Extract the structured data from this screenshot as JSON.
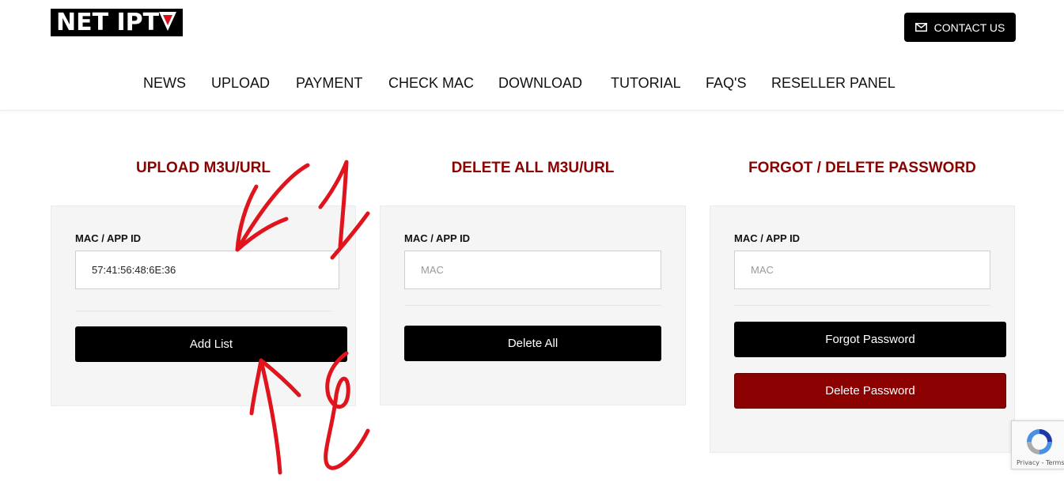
{
  "header": {
    "logo_text": "NET IPT",
    "contact_label": "CONTACT US"
  },
  "nav": {
    "items": [
      {
        "label": "NEWS"
      },
      {
        "label": "UPLOAD"
      },
      {
        "label": "PAYMENT"
      },
      {
        "label": "CHECK MAC"
      },
      {
        "label": "DOWNLOAD"
      },
      {
        "label": "TUTORIAL"
      },
      {
        "label": "FAQ'S"
      },
      {
        "label": "RESELLER PANEL"
      }
    ]
  },
  "upload": {
    "title": "UPLOAD M3U/URL",
    "field_label": "MAC / APP ID",
    "field_value": "57:41:56:48:6E:36",
    "button_label": "Add List"
  },
  "delete_all": {
    "title": "DELETE ALL M3U/URL",
    "field_label": "MAC / APP ID",
    "field_placeholder": "MAC",
    "button_label": "Delete All"
  },
  "password": {
    "title": "FORGOT / DELETE PASSWORD",
    "field_label": "MAC / APP ID",
    "field_placeholder": "MAC",
    "forgot_label": "Forgot Password",
    "delete_label": "Delete Password"
  },
  "recaptcha": {
    "footer_text": "Privacy - Terms"
  },
  "colors": {
    "accent_red": "#8b0000",
    "annotation_red": "#e0141c",
    "button_black": "#000000",
    "card_bg": "#f5f5f5"
  },
  "icons": {
    "contact": "envelope-icon",
    "logo_mark": "red-triangle-v-icon",
    "recaptcha": "recaptcha-icon"
  }
}
